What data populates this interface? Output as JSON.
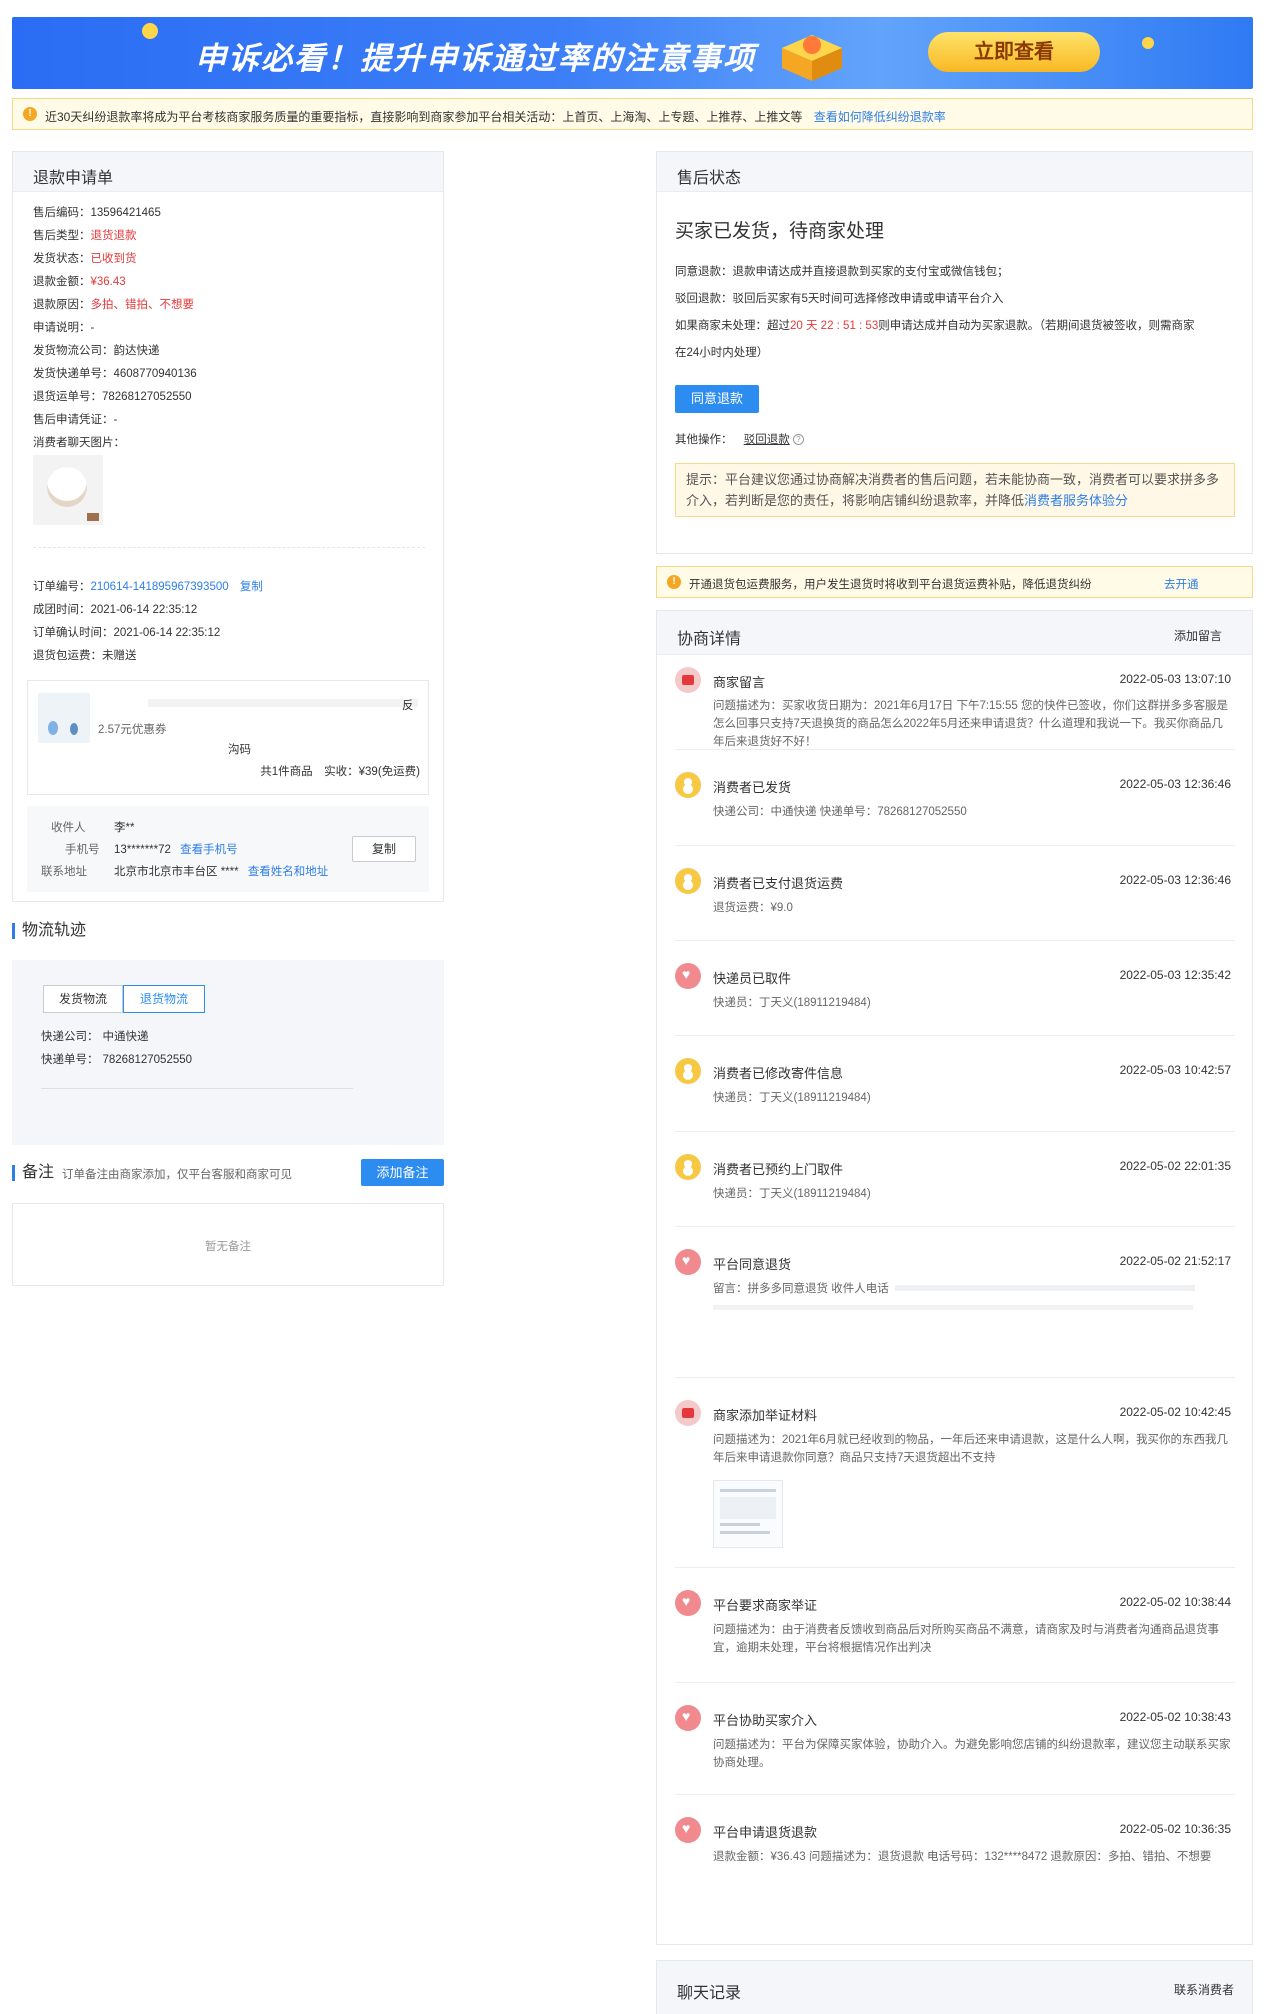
{
  "banner": {
    "title": "申诉必看！提升申诉通过率的注意事项",
    "button": "立即查看"
  },
  "notice": {
    "text": "近30天纠纷退款率将成为平台考核商家服务质量的重要指标，直接影响到商家参加平台相关活动：上首页、上海淘、上专题、上推荐、上推文等",
    "link": "查看如何降低纠纷退款率"
  },
  "refund": {
    "title": "退款申请单",
    "rows": [
      {
        "label": "售后编码：",
        "value": "13596421465"
      },
      {
        "label": "售后类型：",
        "value": "退货退款"
      },
      {
        "label": "发货状态：",
        "value": "已收到货"
      },
      {
        "label": "退款金额：",
        "value": "¥36.43"
      },
      {
        "label": "退款原因：",
        "value": "多拍、错拍、不想要"
      },
      {
        "label": "申请说明：",
        "value": "-"
      },
      {
        "label": "发货物流公司：",
        "value": "韵达快递"
      },
      {
        "label": "发货快递单号：",
        "value": "4608770940136"
      },
      {
        "label": "退货运单号：",
        "value": "78268127052550"
      },
      {
        "label": "售后申请凭证：",
        "value": "-"
      },
      {
        "label": "消费者聊天图片：",
        "value": ""
      }
    ],
    "order": [
      {
        "label": "订单编号：",
        "value": "210614-141895967393500",
        "action": "复制"
      },
      {
        "label": "成团时间：",
        "value": "2021-06-14 22:35:12"
      },
      {
        "label": "订单确认时间：",
        "value": "2021-06-14 22:35:12"
      },
      {
        "label": "退货包运费：",
        "value": "未赠送"
      }
    ],
    "goods": {
      "side_char": "反",
      "coupon": "2.57元优惠券",
      "code_tail": "沟码",
      "summary": "共1件商品　实收：¥39(免运费)"
    },
    "address": {
      "receiver_label": "收件人",
      "receiver": "李**",
      "phone_label": "手机号",
      "phone": "13*******72",
      "phone_link": "查看手机号",
      "addr_label": "联系地址",
      "addr": "北京市北京市丰台区 ****",
      "addr_link": "查看姓名和地址",
      "copy": "复制"
    }
  },
  "logistics": {
    "title": "物流轨迹",
    "tabs": [
      "发货物流",
      "退货物流"
    ],
    "company_label": "快递公司：",
    "company": "中通快递",
    "no_label": "快递单号：",
    "no": "78268127052550"
  },
  "remark": {
    "title": "备注",
    "hint": "订单备注由商家添加，仅平台客服和商家可见",
    "button": "添加备注",
    "empty": "暂无备注"
  },
  "status": {
    "title": "售后状态",
    "headline": "买家已发货，待商家处理",
    "line1": "同意退款：退款申请达成并直接退款到买家的支付宝或微信钱包；",
    "line2": "驳回退款：驳回后买家有5天时间可选择修改申请或申请平台介入",
    "line3_pre": "如果商家未处理：超过",
    "countdown": "20 天 22 : 51 : 53",
    "line3_post": "则申请达成并自动为买家退款。（若期间退货被签收，则需商家",
    "line4": "在24小时内处理）",
    "agree_btn": "同意退款",
    "other_label": "其他操作：",
    "reject_link": "驳回退款",
    "tip": "提示：平台建议您通过协商解决消费者的售后问题，若未能协商一致，消费者可以要求拼多多介入，若判断是您的责任，将影响店铺纠纷退款率，并降低",
    "tip_link": "消费者服务体验分"
  },
  "notice2": {
    "text": "开通退货包运费服务，用户发生退货时将收到平台退货运费补贴，降低退货纠纷",
    "link": "去开通"
  },
  "negotiation": {
    "title": "协商详情",
    "add_link": "添加留言",
    "events": [
      {
        "title": "商家留言",
        "time": "2022-05-03 13:07:10",
        "desc": "问题描述为：买家收货日期为：2021年6月17日 下午7:15:55 您的快件已签收，你们这群拼多多客服是怎么回事只支持7天退换货的商品怎么2022年5月还来申请退货？什么道理和我说一下。我买你商品几年后来退货好不好！"
      },
      {
        "title": "消费者已发货",
        "time": "2022-05-03 12:36:46",
        "desc": "快递公司：中通快递 快递单号：78268127052550"
      },
      {
        "title": "消费者已支付退货运费",
        "time": "2022-05-03 12:36:46",
        "desc": "退货运费：¥9.0"
      },
      {
        "title": "快递员已取件",
        "time": "2022-05-03 12:35:42",
        "desc": "快递员：丁天义(18911219484)"
      },
      {
        "title": "消费者已修改寄件信息",
        "time": "2022-05-03 10:42:57",
        "desc": "快递员：丁天义(18911219484)"
      },
      {
        "title": "消费者已预约上门取件",
        "time": "2022-05-02 22:01:35",
        "desc": "快递员：丁天义(18911219484)"
      },
      {
        "title": "平台同意退货",
        "time": "2022-05-02 21:52:17",
        "desc": "留言：拼多多同意退货 收件人电话"
      },
      {
        "title": "商家添加举证材料",
        "time": "2022-05-02 10:42:45",
        "desc": "问题描述为：2021年6月就已经收到的物品，一年后还来申请退款，这是什么人啊，我买你的东西我几年后来申请退款你同意？商品只支持7天退货超出不支持"
      },
      {
        "title": "平台要求商家举证",
        "time": "2022-05-02 10:38:44",
        "desc": "问题描述为：由于消费者反馈收到商品后对所购买商品不满意，请商家及时与消费者沟通商品退货事宜，逾期未处理，平台将根据情况作出判决"
      },
      {
        "title": "平台协助买家介入",
        "time": "2022-05-02 10:38:43",
        "desc": "问题描述为：平台为保障买家体验，协助介入。为避免影响您店铺的纠纷退款率，建议您主动联系买家协商处理。"
      },
      {
        "title": "平台申请退货退款",
        "time": "2022-05-02 10:36:35",
        "desc": "退款金额：¥36.43 问题描述为：退货退款 电话号码：132****8472 退款原因：多拍、错拍、不想要"
      }
    ]
  },
  "chat": {
    "title": "聊天记录",
    "link": "联系消费者"
  }
}
